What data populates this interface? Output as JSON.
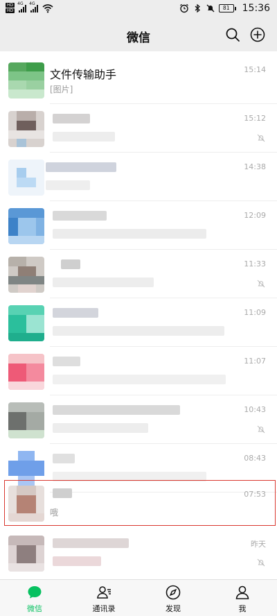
{
  "status_bar": {
    "hd_labels": [
      "HD",
      "HD"
    ],
    "signal_labels": [
      "4G",
      "4G"
    ],
    "battery": "81",
    "time": "15:36"
  },
  "header": {
    "title": "微信",
    "icons": [
      "search-icon",
      "add-icon"
    ]
  },
  "chats": [
    {
      "name": "文件传输助手",
      "preview": "[图片]",
      "time": "15:14",
      "muted": false,
      "avatar_color": "#4cae5a"
    },
    {
      "name": "",
      "preview": "",
      "time": "15:12",
      "muted": true,
      "avatar_color": "#8a7b78"
    },
    {
      "name": "",
      "preview": "",
      "time": "14:38",
      "muted": false,
      "avatar_color": "#8ec0e6"
    },
    {
      "name": "",
      "preview": "",
      "time": "12:09",
      "muted": false,
      "avatar_color": "#4a8ed1"
    },
    {
      "name": "",
      "preview": "",
      "time": "11:33",
      "muted": true,
      "avatar_color": "#9a9690"
    },
    {
      "name": "",
      "preview": "",
      "time": "11:09",
      "muted": false,
      "avatar_color": "#3ec5a5"
    },
    {
      "name": "",
      "preview": "",
      "time": "11:07",
      "muted": false,
      "avatar_color": "#ea5a6e"
    },
    {
      "name": "",
      "preview": "",
      "time": "10:43",
      "muted": true,
      "avatar_color": "#8c8f8a"
    },
    {
      "name": "",
      "preview": "",
      "time": "08:43",
      "muted": false,
      "avatar_color": "#7aa9ee"
    },
    {
      "name": "",
      "preview": "哦",
      "time": "07:53",
      "muted": false,
      "avatar_color": "#b79a8e"
    },
    {
      "name": "",
      "preview": "",
      "time": "昨天",
      "muted": true,
      "avatar_color": "#9b8f8f"
    }
  ],
  "bottom_nav": [
    {
      "label": "微信",
      "icon": "chat-bubble-icon",
      "active": true
    },
    {
      "label": "通讯录",
      "icon": "contacts-icon",
      "active": false
    },
    {
      "label": "发现",
      "icon": "compass-icon",
      "active": false
    },
    {
      "label": "我",
      "icon": "person-icon",
      "active": false
    }
  ],
  "colors": {
    "accent": "#07c160",
    "highlight_border": "#d9372f",
    "background": "#ededed"
  }
}
